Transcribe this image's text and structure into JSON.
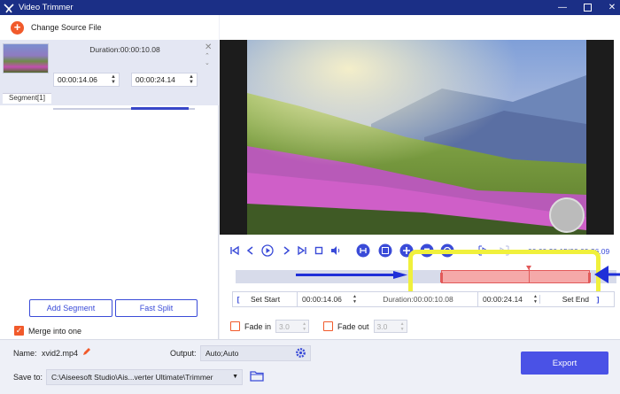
{
  "window": {
    "title": "Video Trimmer"
  },
  "header": {
    "change_source_label": "Change Source File"
  },
  "segment": {
    "duration": "Duration:00:00:10.08",
    "start": "00:00:14.06",
    "end": "00:00:24.14",
    "label": "Segment[1]",
    "progress_fraction": 0.4
  },
  "left_buttons": {
    "add_segment": "Add Segment",
    "fast_split": "Fast Split"
  },
  "merge": {
    "label": "Merge into one",
    "checked": true
  },
  "player": {
    "current_time": "00:00:20.15/00:00:26.09",
    "playhead_fraction": 0.77
  },
  "trim": {
    "set_start_label": "Set Start",
    "start": "00:00:14.06",
    "duration": "Duration:00:00:10.08",
    "end": "00:00:24.14",
    "set_end_label": "Set End",
    "selection_start_fraction": 0.54,
    "selection_end_fraction": 0.93
  },
  "fade_in": {
    "label": "Fade in",
    "value": "3.0",
    "checked": false
  },
  "fade_out": {
    "label": "Fade out",
    "value": "3.0",
    "checked": false
  },
  "output": {
    "name_label": "Name:",
    "name_value": "xvid2.mp4",
    "output_label": "Output:",
    "output_value": "Auto;Auto",
    "save_label": "Save to:",
    "save_path": "C:\\Aiseesoft Studio\\Ais...verter Ultimate\\Trimmer",
    "export_label": "Export"
  },
  "colors": {
    "accent": "#3a4bd8",
    "orange": "#f15a2b",
    "highlight": "#f0f03c",
    "arrow": "#1f2fd8"
  }
}
